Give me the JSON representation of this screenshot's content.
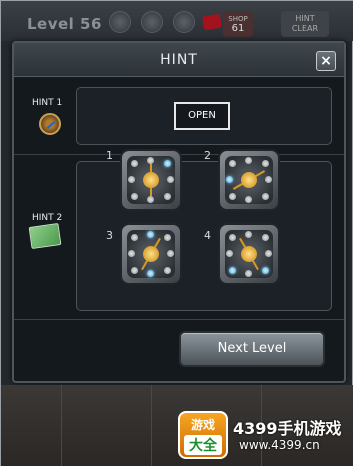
{
  "topbar": {
    "level": "Level 56",
    "shop_label": "SHOP",
    "shop_count": "61",
    "hint_clear_line1": "HINT",
    "hint_clear_line2": "CLEAR"
  },
  "dialog": {
    "title": "HINT",
    "close_symbol": "×",
    "hint1_label": "HINT 1",
    "hint1_icon": "compass-icon",
    "open_label": "OPEN",
    "hint2_label": "HINT 2",
    "hint2_icon": "map-icon",
    "tiles": [
      {
        "number": "1"
      },
      {
        "number": "2"
      },
      {
        "number": "3"
      },
      {
        "number": "4"
      }
    ],
    "next_label": "Next Level"
  },
  "watermark": {
    "logo_top": "游戏",
    "logo_bottom": "大全",
    "brand": "4399手机游戏",
    "url": "www.4399.cn"
  },
  "colors": {
    "accent_blue": "#4aa5d6",
    "gold": "#d79a22",
    "panel": "#1b2126"
  }
}
